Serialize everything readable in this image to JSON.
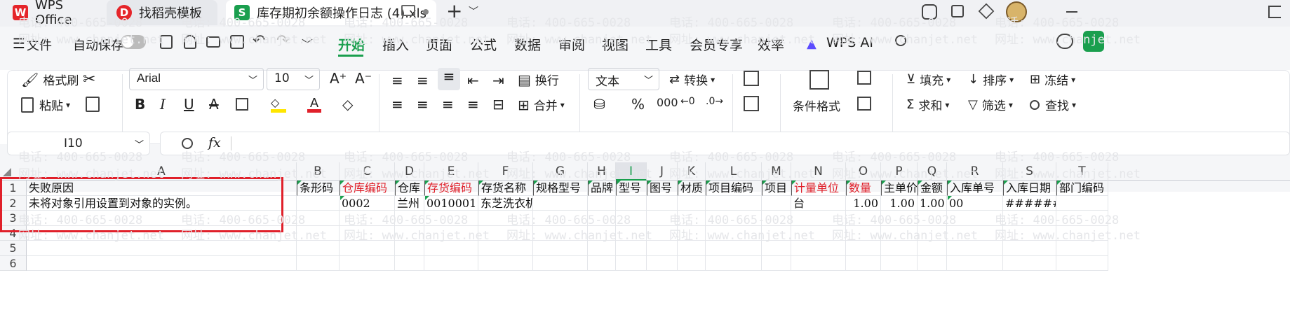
{
  "titlebar": {
    "tabs": [
      {
        "label": "WPS Office",
        "icon": "wps-logo-icon",
        "color": "#e5252a"
      },
      {
        "label": "找稻壳模板",
        "icon": "docer-icon",
        "color": "#e5252a"
      },
      {
        "label": "库存期初余额操作日志 (4).xls",
        "icon": "sheet-icon",
        "color": "#1a9f4e"
      }
    ],
    "new_tab": "+"
  },
  "menubar": {
    "file_label": "文件",
    "autosave_label": "自动保存",
    "items": [
      "开始",
      "插入",
      "页面",
      "公式",
      "数据",
      "审阅",
      "视图",
      "工具",
      "会员专享",
      "效率"
    ],
    "active": "开始",
    "ai_label": "WPS AI"
  },
  "ribbon": {
    "format_painter": "格式刷",
    "paste": "粘贴",
    "font_name": "Arial",
    "font_size": "10",
    "wrap": "换行",
    "merge": "合并",
    "number_format": "文本",
    "convert": "转换",
    "conditional_format": "条件格式",
    "fill": "填充",
    "sort": "排序",
    "freeze": "冻结",
    "sum": "求和",
    "filter": "筛选",
    "find": "查找"
  },
  "formula_bar": {
    "cell_ref": "I10",
    "fx": "fx",
    "value": ""
  },
  "sheet": {
    "columns": [
      "A",
      "B",
      "C",
      "D",
      "E",
      "F",
      "G",
      "H",
      "I",
      "J",
      "K",
      "L",
      "M",
      "N",
      "O",
      "P",
      "Q",
      "R",
      "S",
      "T"
    ],
    "selected_column": "I",
    "rows": [
      "1",
      "2",
      "3",
      "4",
      "5",
      "6"
    ],
    "header_row": [
      "失败原因",
      "条形码",
      "仓库编码",
      "仓库",
      "存货编码",
      "存货名称",
      "规格型号",
      "品牌",
      "型号",
      "图号",
      "材质",
      "项目编码",
      "项目",
      "计量单位",
      "数量",
      "主单价",
      "金额",
      "入库单号",
      "入库日期",
      "部门编码"
    ],
    "data_row": [
      "未将对象引用设置到对象的实例。",
      "",
      "0002",
      "兰州",
      "0010001",
      "东芝洗衣机",
      "",
      "",
      "",
      "",
      "",
      "",
      "",
      "台",
      "1.00",
      "1.00",
      "1.00",
      "00",
      "#######",
      ""
    ]
  },
  "watermark": {
    "phone": "电话: 400-665-0028",
    "site": "网址: www.chanjet.net"
  },
  "colors": {
    "accent": "#1a9f4e",
    "required_header": "#e0202a",
    "highlight_box": "#e0202a"
  }
}
